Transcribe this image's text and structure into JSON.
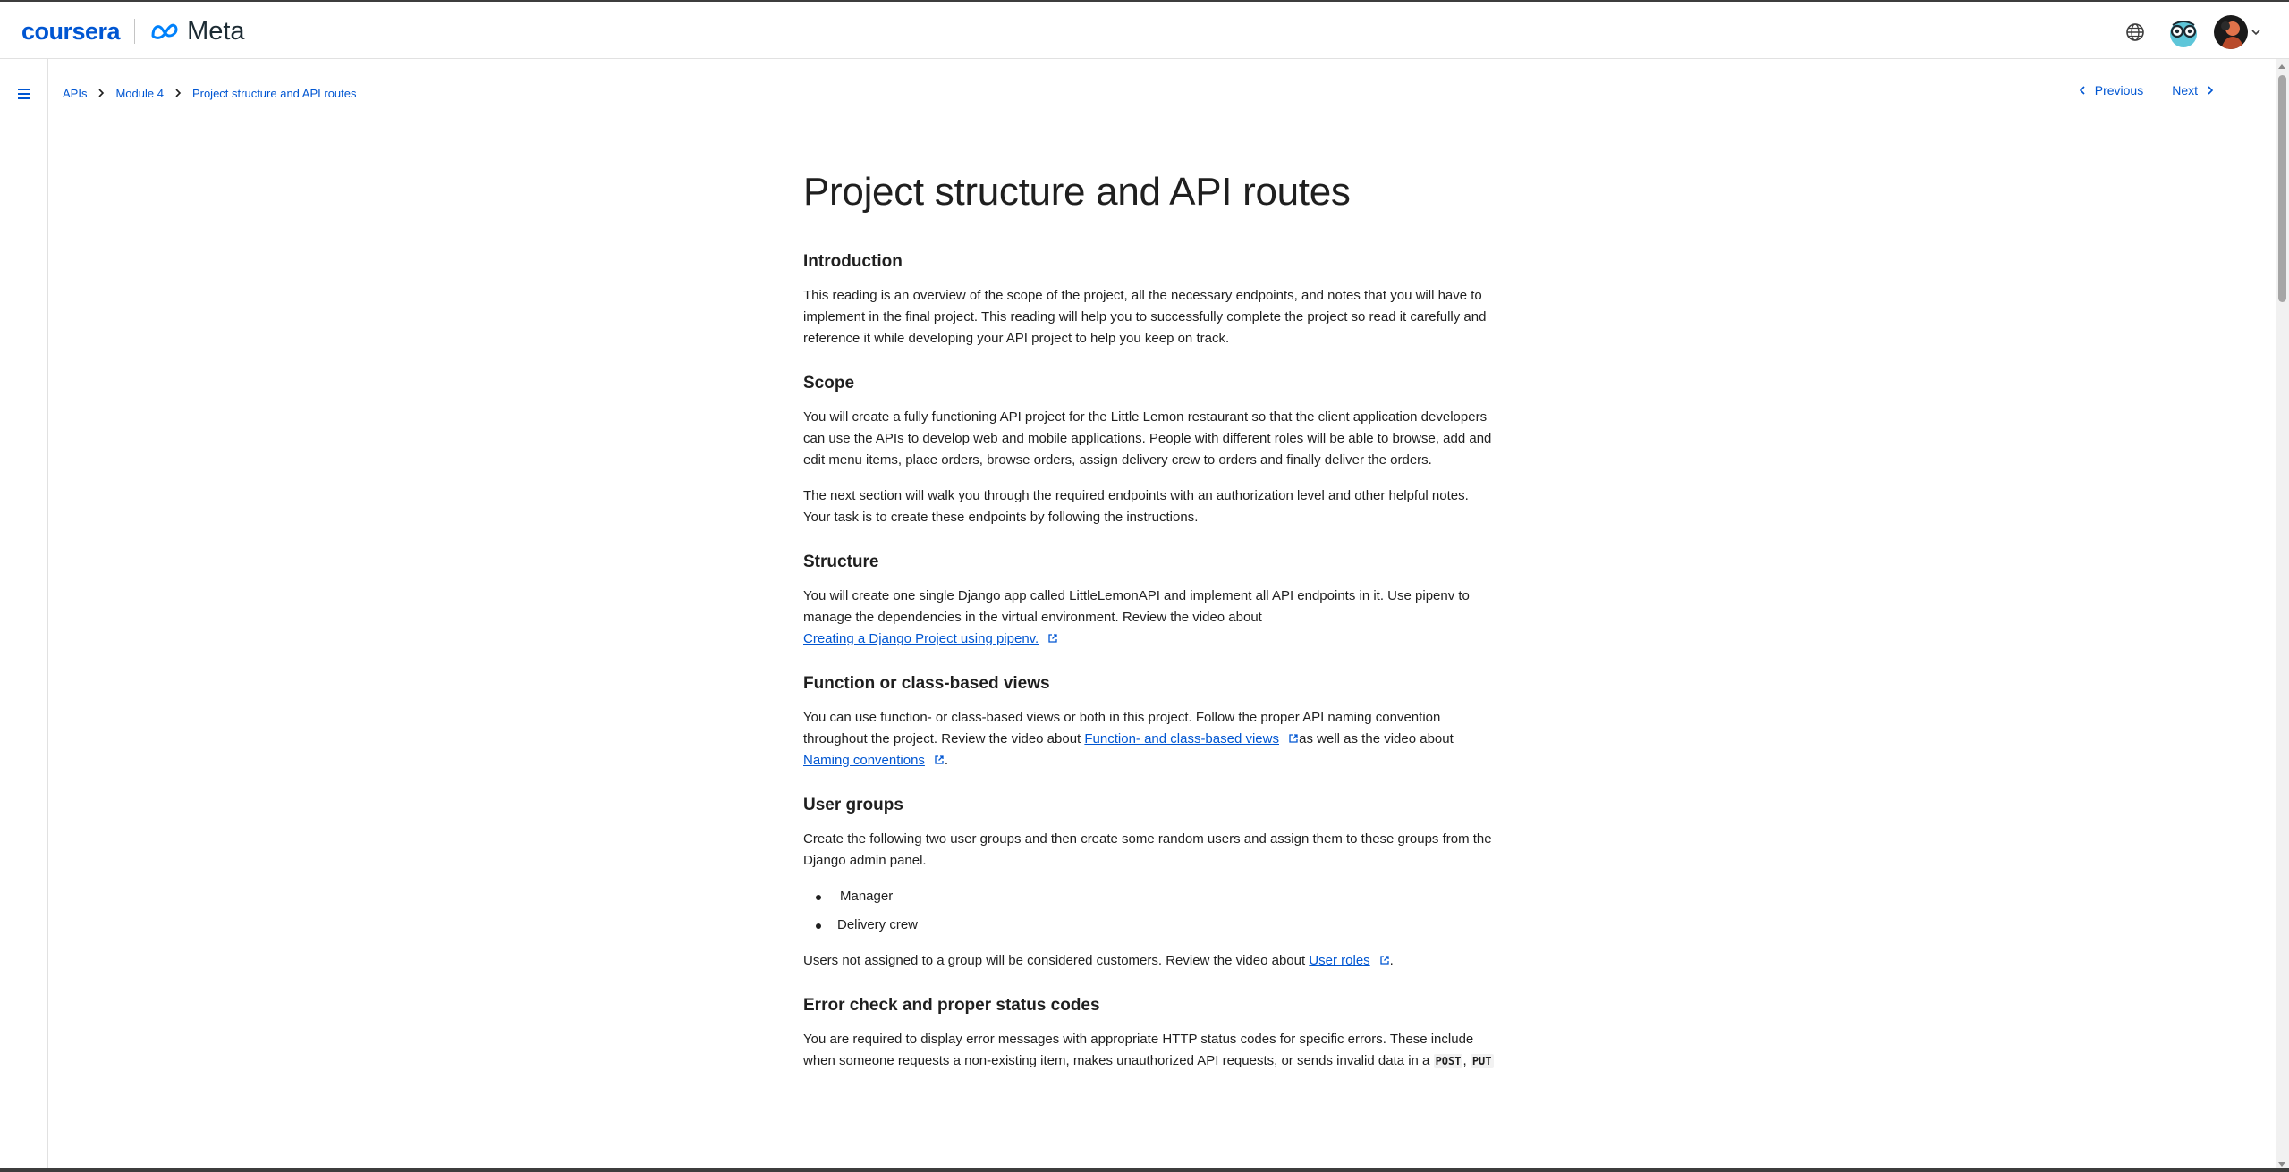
{
  "header": {
    "brand_coursera": "coursera",
    "brand_meta": "Meta",
    "icons": [
      "globe-icon",
      "mascot-icon",
      "avatar",
      "chevron-down-icon"
    ]
  },
  "breadcrumb": {
    "items": [
      "APIs",
      "Module 4",
      "Project structure and API routes"
    ]
  },
  "nav": {
    "previous": "Previous",
    "next": "Next"
  },
  "article": {
    "title": "Project structure and API routes",
    "introduction": {
      "heading": "Introduction",
      "body": "This reading is an overview of the scope of the project, all the necessary endpoints, and notes that you will have to implement in the final project. This reading will help you to successfully complete the project so read it carefully and reference it while developing your API project to help you keep on track."
    },
    "scope": {
      "heading": "Scope",
      "body1": "You will create a fully functioning API project for the Little Lemon restaurant so that the client application developers can use the APIs to develop web and mobile applications. People with different roles will be able to browse, add and edit menu items, place orders, browse orders, assign delivery crew to orders and finally deliver the orders.",
      "body2": "The next section will walk you through the required endpoints with an authorization level and other helpful notes. Your task is to create these endpoints by following the instructions."
    },
    "structure": {
      "heading": "Structure",
      "body": "You will create one single Django app called LittleLemonAPI and implement all API endpoints in it. Use pipenv to manage the dependencies in the virtual environment. Review the video about",
      "link": "Creating a Django Project using pipenv."
    },
    "views": {
      "heading": "Function or class-based views",
      "body_before": "You can use function- or class-based views or both in this project. Follow the proper API naming convention throughout the project. Review the video about ",
      "link1": "Function- and class-based views",
      "body_middle": " as well as the video about",
      "link2": "Naming conventions",
      "body_end": "."
    },
    "user_groups": {
      "heading": "User groups",
      "body": "Create the following two user groups and then create some random users and assign them to these groups from the Django admin panel.",
      "items": [
        "Manager",
        "Delivery crew"
      ],
      "after_before": "Users not assigned to a group will be considered customers. Review the video about ",
      "after_link": "User roles",
      "after_end": "."
    },
    "errors": {
      "heading": "Error check and proper status codes",
      "body": "You are required to display error messages with appropriate HTTP status codes for specific errors. These include when someone requests a non-existing item, makes unauthorized API requests, or sends invalid data in a ",
      "code1": "POST",
      "sep": ", ",
      "code2": "PUT"
    }
  },
  "colors": {
    "link": "#0056d2",
    "text": "#1f1f1f",
    "border": "#e1e1e1"
  }
}
